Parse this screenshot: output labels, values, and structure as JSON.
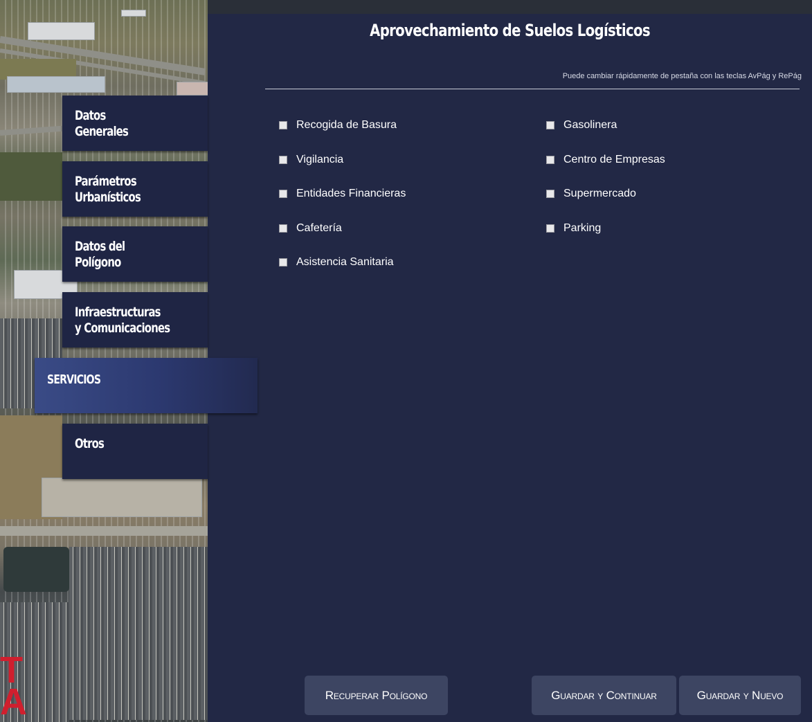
{
  "app": {
    "title": "Aprovechamiento de Suelos Logísticos",
    "hint": "Puede cambiar rápidamente de pestaña con las teclas AvPág y RePág"
  },
  "tabs": [
    {
      "label": "Datos\nGenerales",
      "active": false
    },
    {
      "label": "Parámetros\nUrbanísticos",
      "active": false
    },
    {
      "label": "Datos del\nPolígono",
      "active": false
    },
    {
      "label": "Infraestructuras\ny Comunicaciones",
      "active": false
    },
    {
      "label": "SERVICIOS",
      "active": true
    },
    {
      "label": "Otros",
      "active": false
    }
  ],
  "services": {
    "left": [
      {
        "label": "Recogida de Basura",
        "checked": false
      },
      {
        "label": "Vigilancia",
        "checked": false
      },
      {
        "label": "Entidades Financieras",
        "checked": false
      },
      {
        "label": "Cafetería",
        "checked": false
      },
      {
        "label": "Asistencia Sanitaria",
        "checked": false
      }
    ],
    "right": [
      {
        "label": "Gasolinera",
        "checked": false
      },
      {
        "label": "Centro de Empresas",
        "checked": false
      },
      {
        "label": "Supermercado",
        "checked": false
      },
      {
        "label": "Parking",
        "checked": false
      }
    ]
  },
  "buttons": {
    "recover": "Recuperar Polígono",
    "save_continue": "Guardar y Continuar",
    "save_new": "Guardar y Nuevo"
  },
  "colors": {
    "panel_bg": "#222845",
    "tab_bg": "#1f2544",
    "tab_active": "#3a4b86",
    "button_bg": "#3d4562",
    "text": "#ffffff"
  }
}
